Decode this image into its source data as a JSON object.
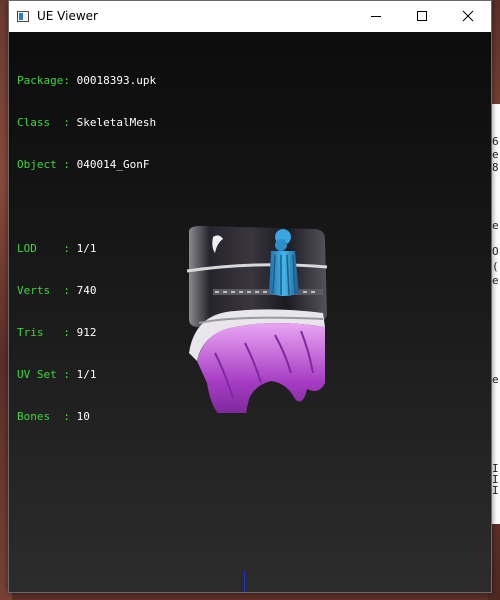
{
  "window": {
    "title": "UE Viewer"
  },
  "info": {
    "package": {
      "label": "Package: ",
      "value": "00018393.upk"
    },
    "class": {
      "label": "Class  : ",
      "value": "SkeletalMesh"
    },
    "object": {
      "label": "Object : ",
      "value": "040014_GonF"
    },
    "lod": {
      "label": "LOD    : ",
      "value": "1/1"
    },
    "verts": {
      "label": "Verts  : ",
      "value": "740"
    },
    "tris": {
      "label": "Tris   : ",
      "value": "912"
    },
    "uvset": {
      "label": "UV Set : ",
      "value": "1/1"
    },
    "bones": {
      "label": "Bones  : ",
      "value": "10"
    }
  },
  "colors": {
    "label_green": "#3cd83c",
    "value_white": "#ffffff",
    "viewport_top": "#0c0c0c",
    "viewport_bottom": "#2c2c2c",
    "axis_blue": "#2030d0"
  },
  "icons": {
    "app": "app-icon",
    "minimize": "minimize-icon",
    "maximize": "maximize-icon",
    "close": "close-icon"
  },
  "background_peek": [
    "6",
    "e",
    "8",
    "e",
    "O",
    "(",
    "e",
    "e",
    "I",
    "I",
    "I"
  ]
}
